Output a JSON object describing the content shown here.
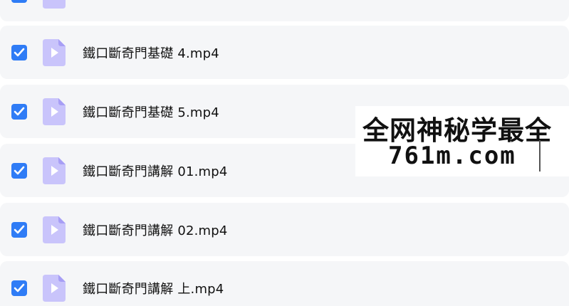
{
  "colors": {
    "row_background": "#f5f6f8",
    "checkbox_accent": "#2f7cf6",
    "file_icon_light": "#c9c4fb",
    "file_icon_dark": "#a79ef5"
  },
  "files": [
    {
      "name": "",
      "checked": true,
      "icon": "video-file-icon"
    },
    {
      "name": "鐵口斷奇門基礎 4.mp4",
      "checked": true,
      "icon": "video-file-icon"
    },
    {
      "name": "鐵口斷奇門基礎 5.mp4",
      "checked": true,
      "icon": "video-file-icon"
    },
    {
      "name": "鐵口斷奇門講解 01.mp4",
      "checked": true,
      "icon": "video-file-icon"
    },
    {
      "name": "鐵口斷奇門講解 02.mp4",
      "checked": true,
      "icon": "video-file-icon"
    },
    {
      "name": "鐵口斷奇門講解 上.mp4",
      "checked": true,
      "icon": "video-file-icon"
    }
  ],
  "watermark": {
    "line1": "全网神秘学最全",
    "line2": "761m.com"
  }
}
